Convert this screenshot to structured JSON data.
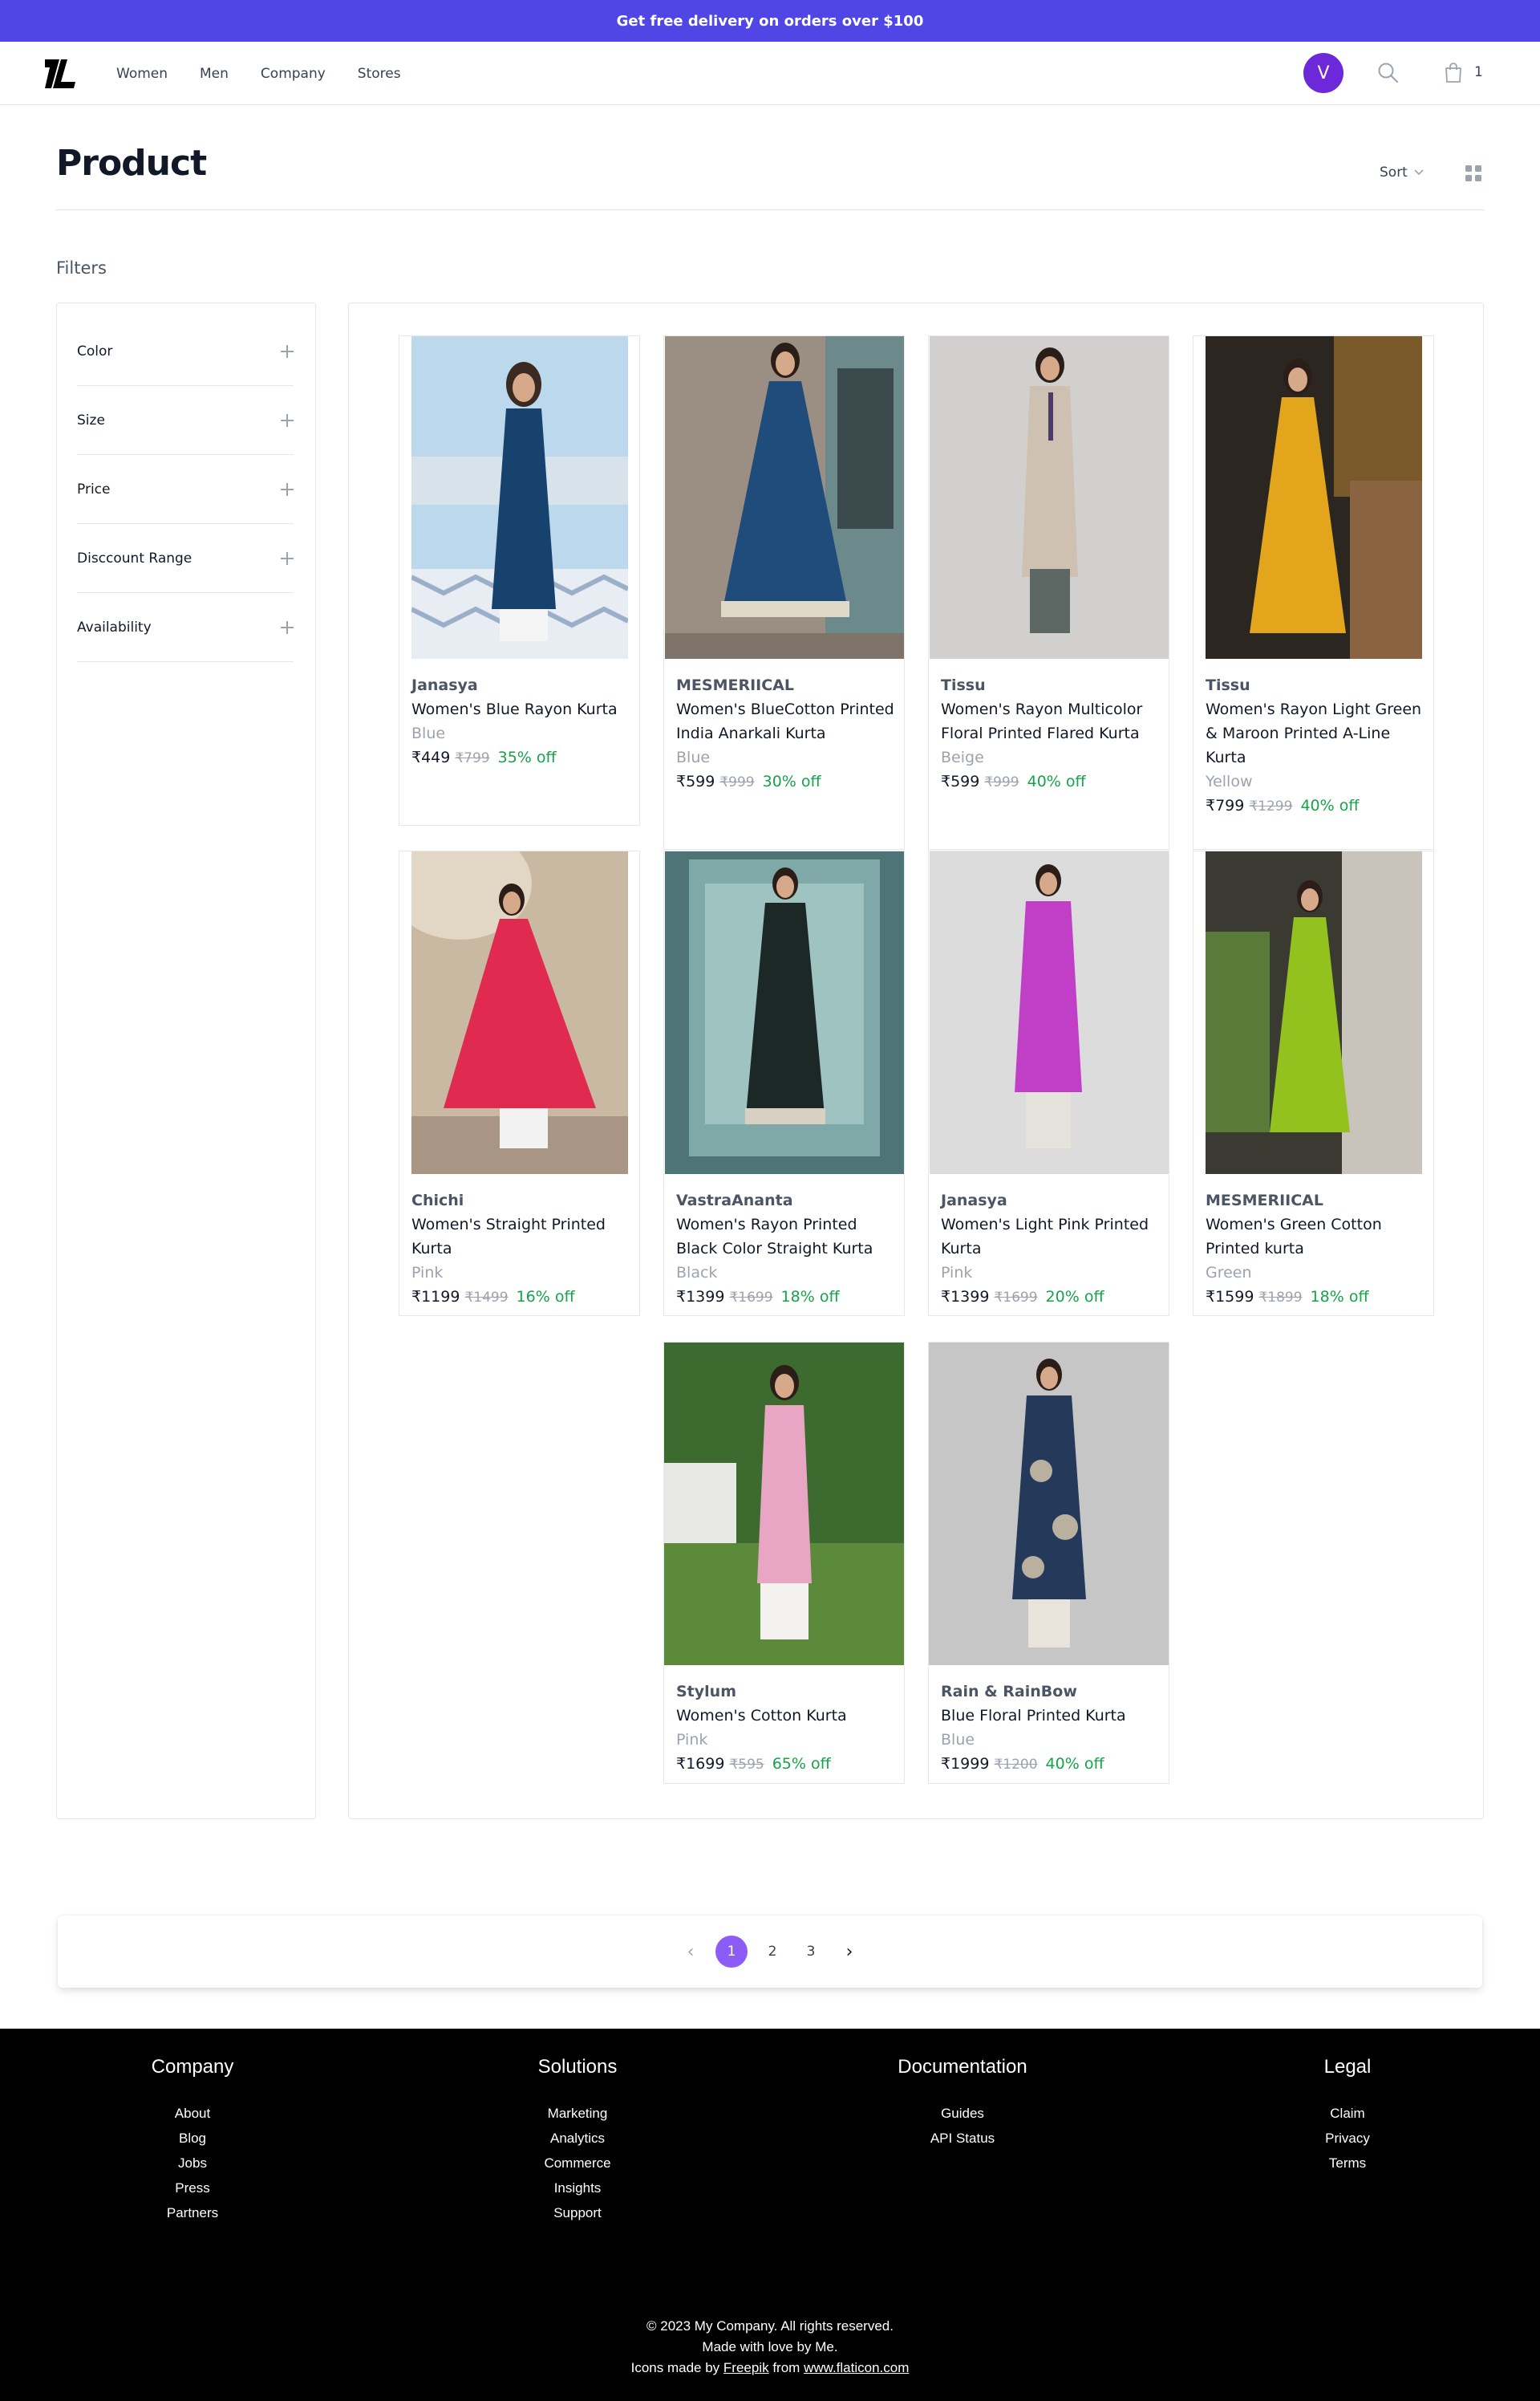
{
  "promo": {
    "text": "Get free delivery on orders over $100"
  },
  "nav": {
    "items": [
      "Women",
      "Men",
      "Company",
      "Stores"
    ]
  },
  "header": {
    "avatar_initial": "V",
    "cart_count": "1",
    "accent": "#4f46e5",
    "avatar_color": "#6d28d9"
  },
  "page": {
    "title": "Product",
    "sort_label": "Sort",
    "filters_label": "Filters"
  },
  "filters": [
    "Color",
    "Size",
    "Price",
    "Disccount Range",
    "Availability"
  ],
  "products": [
    {
      "brand": "Janasya",
      "title": "Women's Blue Rayon Kurta",
      "color": "Blue",
      "price": "₹449",
      "mrp": "₹799",
      "off": "35% off"
    },
    {
      "brand": "MESMERIICAL",
      "title": "Women's BlueCotton Printed India Anarkali Kurta",
      "color": "Blue",
      "price": "₹599",
      "mrp": "₹999",
      "off": "30% off"
    },
    {
      "brand": "Tissu",
      "title": "Women's Rayon Multicolor Floral Printed Flared Kurta",
      "color": "Beige",
      "price": "₹599",
      "mrp": "₹999",
      "off": "40% off"
    },
    {
      "brand": "Tissu",
      "title": "Women's Rayon Light Green & Maroon Printed A-Line Kurta",
      "color": "Yellow",
      "price": "₹799",
      "mrp": "₹1299",
      "off": "40% off"
    },
    {
      "brand": "Chichi",
      "title": "Women's Straight Printed Kurta",
      "color": "Pink",
      "price": "₹1199",
      "mrp": "₹1499",
      "off": "16% off"
    },
    {
      "brand": "VastraAnanta",
      "title": "Women's Rayon Printed Black Color Straight Kurta",
      "color": "Black",
      "price": "₹1399",
      "mrp": "₹1699",
      "off": "18% off"
    },
    {
      "brand": "Janasya",
      "title": "Women's Light Pink Printed Kurta",
      "color": "Pink",
      "price": "₹1399",
      "mrp": "₹1699",
      "off": "20% off"
    },
    {
      "brand": "MESMERIICAL",
      "title": "Women's Green Cotton Printed kurta",
      "color": "Green",
      "price": "₹1599",
      "mrp": "₹1899",
      "off": "18% off"
    },
    {
      "brand": "Stylum",
      "title": "Women's Cotton Kurta",
      "color": "Pink",
      "price": "₹1699",
      "mrp": "₹595",
      "off": "65% off"
    },
    {
      "brand": "Rain & RainBow",
      "title": "Blue Floral Printed Kurta",
      "color": "Blue",
      "price": "₹1999",
      "mrp": "₹1200",
      "off": "40% off"
    }
  ],
  "pagination": {
    "prev": "‹",
    "pages": [
      "1",
      "2",
      "3"
    ],
    "next": "›",
    "active": "1"
  },
  "footer": {
    "columns": [
      {
        "title": "Company",
        "links": [
          "About",
          "Blog",
          "Jobs",
          "Press",
          "Partners"
        ]
      },
      {
        "title": "Solutions",
        "links": [
          "Marketing",
          "Analytics",
          "Commerce",
          "Insights",
          "Support"
        ]
      },
      {
        "title": "Documentation",
        "links": [
          "Guides",
          "API Status"
        ]
      },
      {
        "title": "Legal",
        "links": [
          "Claim",
          "Privacy",
          "Terms"
        ]
      }
    ],
    "copyright": "© 2023 My Company. All rights reserved.",
    "made_with": "Made with love by Me.",
    "icons_prefix": "Icons made by",
    "icons_author": "Freepik",
    "icons_from": "from",
    "icons_site": "www.flaticon.com"
  }
}
